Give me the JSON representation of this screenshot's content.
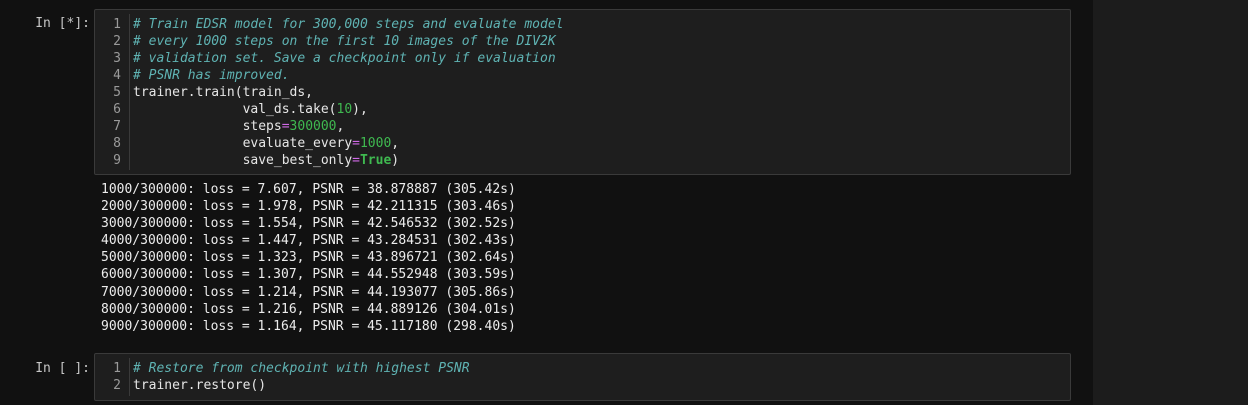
{
  "cells": [
    {
      "prompt": "In [*]:",
      "lines": [
        {
          "num": "1",
          "tokens": [
            {
              "t": "# Train EDSR model for 300,000 steps and evaluate model",
              "c": "cm"
            }
          ]
        },
        {
          "num": "2",
          "tokens": [
            {
              "t": "# every 1000 steps on the first 10 images of the DIV2K",
              "c": "cm"
            }
          ]
        },
        {
          "num": "3",
          "tokens": [
            {
              "t": "# validation set. Save a checkpoint only if evaluation",
              "c": "cm"
            }
          ]
        },
        {
          "num": "4",
          "tokens": [
            {
              "t": "# PSNR has improved.",
              "c": "cm"
            }
          ]
        },
        {
          "num": "5",
          "tokens": [
            {
              "t": "trainer.train(train_ds,",
              "c": "pl"
            }
          ]
        },
        {
          "num": "6",
          "tokens": [
            {
              "t": "              val_ds.take(",
              "c": "pl"
            },
            {
              "t": "10",
              "c": "nm"
            },
            {
              "t": "),",
              "c": "pl"
            }
          ]
        },
        {
          "num": "7",
          "tokens": [
            {
              "t": "              steps",
              "c": "pl"
            },
            {
              "t": "=",
              "c": "op"
            },
            {
              "t": "300000",
              "c": "nm"
            },
            {
              "t": ",",
              "c": "pl"
            }
          ]
        },
        {
          "num": "8",
          "tokens": [
            {
              "t": "              evaluate_every",
              "c": "pl"
            },
            {
              "t": "=",
              "c": "op"
            },
            {
              "t": "1000",
              "c": "nm"
            },
            {
              "t": ",",
              "c": "pl"
            }
          ]
        },
        {
          "num": "9",
          "tokens": [
            {
              "t": "              save_best_only",
              "c": "pl"
            },
            {
              "t": "=",
              "c": "op"
            },
            {
              "t": "True",
              "c": "kw"
            },
            {
              "t": ")",
              "c": "pl"
            }
          ]
        }
      ],
      "output": [
        "1000/300000: loss = 7.607, PSNR = 38.878887 (305.42s)",
        "2000/300000: loss = 1.978, PSNR = 42.211315 (303.46s)",
        "3000/300000: loss = 1.554, PSNR = 42.546532 (302.52s)",
        "4000/300000: loss = 1.447, PSNR = 43.284531 (302.43s)",
        "5000/300000: loss = 1.323, PSNR = 43.896721 (302.64s)",
        "6000/300000: loss = 1.307, PSNR = 44.552948 (303.59s)",
        "7000/300000: loss = 1.214, PSNR = 44.193077 (305.86s)",
        "8000/300000: loss = 1.216, PSNR = 44.889126 (304.01s)",
        "9000/300000: loss = 1.164, PSNR = 45.117180 (298.40s)"
      ]
    },
    {
      "prompt": "In [ ]:",
      "lines": [
        {
          "num": "1",
          "tokens": [
            {
              "t": "# Restore from checkpoint with highest PSNR",
              "c": "cm"
            }
          ]
        },
        {
          "num": "2",
          "tokens": [
            {
              "t": "trainer.restore()",
              "c": "pl"
            }
          ]
        }
      ],
      "output": []
    }
  ],
  "colors": {
    "background": "#111111",
    "cell_background": "#1e1e1e",
    "comment": "#5fb3b3",
    "number": "#3fb950",
    "operator": "#d16ae8",
    "keyword": "#3fb950"
  }
}
